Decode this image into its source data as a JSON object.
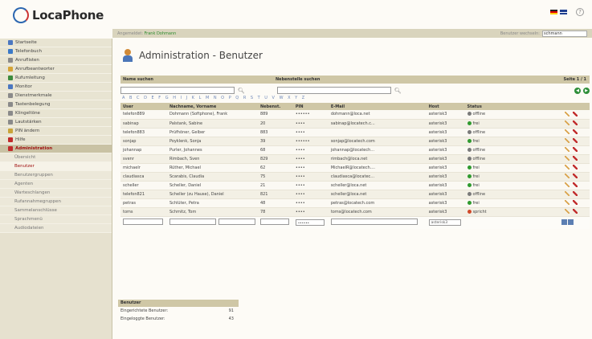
{
  "app": {
    "name": "LocaPhone"
  },
  "topbar": {
    "help_label": "?"
  },
  "session": {
    "logged_in_label": "Angemeldet:",
    "user": "Frank Dohmann",
    "mode_label": "Benutzer wechseln:",
    "mode_value": "schmann"
  },
  "sidebar": {
    "items": [
      {
        "label": "Startseite",
        "icon": "globe-icon",
        "color": "#4b77c0"
      },
      {
        "label": "Telefonbuch",
        "icon": "phonebook-icon",
        "color": "#3a79c8"
      },
      {
        "label": "Anruflisten",
        "icon": "list-icon",
        "color": "#8a8a8a"
      },
      {
        "label": "Anrufbeantworter",
        "icon": "answering-machine-icon",
        "color": "#d5a436"
      },
      {
        "label": "Rufumleitung",
        "icon": "forward-icon",
        "color": "#3d8c3d"
      },
      {
        "label": "Monitor",
        "icon": "monitor-icon",
        "color": "#4b77c0"
      },
      {
        "label": "Dienstmerkmale",
        "icon": "tools-icon",
        "color": "#8a8a8a"
      },
      {
        "label": "Tastenbelegung",
        "icon": "keyboard-icon",
        "color": "#8a8a8a"
      },
      {
        "label": "Klingeltöne",
        "icon": "music-icon",
        "color": "#8a8a8a"
      },
      {
        "label": "Lautstärken",
        "icon": "volume-icon",
        "color": "#8a8a8a"
      },
      {
        "label": "PIN ändern",
        "icon": "key-icon",
        "color": "#c9a43a"
      },
      {
        "label": "Hilfe",
        "icon": "help-icon",
        "color": "#c02a2a"
      },
      {
        "label": "Administration",
        "icon": "admin-icon",
        "color": "#c02a2a"
      }
    ],
    "subitems": [
      "Übersicht",
      "Benutzer",
      "Benutzergruppen",
      "Agenten",
      "Warteschlangen",
      "Rufannahmegruppen",
      "Sammelanschlüsse",
      "Sprachmenü",
      "Audiodateien"
    ],
    "current_subitem": "Benutzer"
  },
  "page": {
    "title": "Administration - Benutzer"
  },
  "search": {
    "name_label": "Name suchen",
    "ext_label": "Nebenstelle suchen",
    "page_label": "Seite 1 / 1",
    "alphabet": "A B C D E F G H I J K L M N O P Q R S T U V W X Y Z"
  },
  "table": {
    "headers": [
      "User",
      "Nachname, Vorname",
      "Nebenst.",
      "PIN",
      "E-Mail",
      "Host",
      "Status"
    ],
    "rows": [
      {
        "user": "telefon889",
        "name": "Dohmann (Softphone), Frank",
        "ext": "889",
        "pin": "••••••",
        "email": "dohmann@loca.net",
        "host": "asterisk3",
        "status": "offline",
        "status_color": "#7a7a7a"
      },
      {
        "user": "sabinap",
        "name": "Palstank, Sabine",
        "ext": "20",
        "pin": "••••",
        "email": "sabinap@locatech.c...",
        "host": "asterisk3",
        "status": "frei",
        "status_color": "#2f9a2f"
      },
      {
        "user": "telefon883",
        "name": "Prüfhöner, Gelber",
        "ext": "883",
        "pin": "••••",
        "email": "",
        "host": "asterisk3",
        "status": "offline",
        "status_color": "#7a7a7a"
      },
      {
        "user": "sonjap",
        "name": "Poyklenk, Sonja",
        "ext": "39",
        "pin": "••••••",
        "email": "sonjap@locatech.com",
        "host": "asterisk3",
        "status": "frei",
        "status_color": "#2f9a2f"
      },
      {
        "user": "johannap",
        "name": "Purler, Johannes",
        "ext": "68",
        "pin": "••••",
        "email": "johannap@locatech...",
        "host": "asterisk3",
        "status": "offline",
        "status_color": "#7a7a7a"
      },
      {
        "user": "svenr",
        "name": "Rimbach, Sven",
        "ext": "829",
        "pin": "••••",
        "email": "rimbach@loca.net",
        "host": "asterisk3",
        "status": "offline",
        "status_color": "#7a7a7a"
      },
      {
        "user": "michaelr",
        "name": "Rüther, Michael",
        "ext": "62",
        "pin": "••••",
        "email": "MichaelR@locatech....",
        "host": "asterisk3",
        "status": "frei",
        "status_color": "#2f9a2f"
      },
      {
        "user": "claudiasca",
        "name": "Scarabis, Claudia",
        "ext": "75",
        "pin": "••••",
        "email": "claudiasca@locatec...",
        "host": "asterisk3",
        "status": "frei",
        "status_color": "#2f9a2f"
      },
      {
        "user": "scheller",
        "name": "Scheller, Daniel",
        "ext": "21",
        "pin": "••••",
        "email": "scheller@loca.net",
        "host": "asterisk3",
        "status": "frei",
        "status_color": "#2f9a2f"
      },
      {
        "user": "telefon821",
        "name": "Scheller (zu Hause), Daniel",
        "ext": "821",
        "pin": "••••",
        "email": "scheller@loca.net",
        "host": "asterisk3",
        "status": "offline",
        "status_color": "#7a7a7a"
      },
      {
        "user": "petras",
        "name": "Schlüter, Petra",
        "ext": "48",
        "pin": "••••",
        "email": "petras@locatech.com",
        "host": "asterisk3",
        "status": "frei",
        "status_color": "#2f9a2f"
      },
      {
        "user": "toms",
        "name": "Schmitz, Tom",
        "ext": "78",
        "pin": "••••",
        "email": "toms@locatech.com",
        "host": "asterisk3",
        "status": "spricht",
        "status_color": "#d0492a"
      }
    ],
    "new_row": {
      "pin_value": "••••••",
      "host_value": "asterisk3"
    }
  },
  "summary": {
    "title": "Benutzer",
    "rows": [
      {
        "label": "Eingerichtete Benutzer:",
        "value": "91"
      },
      {
        "label": "Eingeloggte Benutzer:",
        "value": "43"
      }
    ]
  }
}
